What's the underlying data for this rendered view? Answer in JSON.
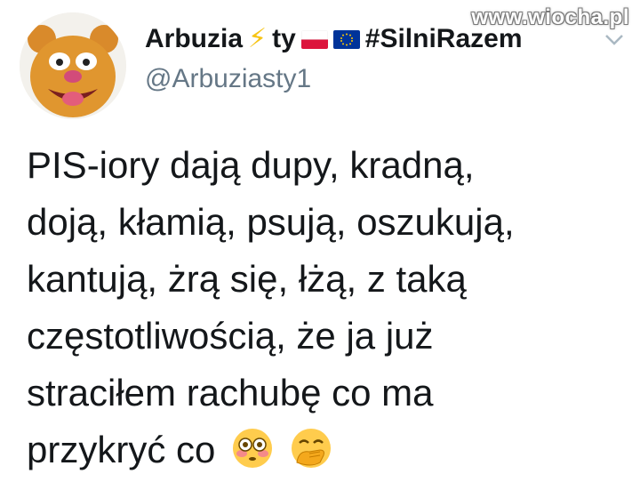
{
  "watermark": "www.wiocha.pl",
  "author": {
    "name_part1": "Arbuzia",
    "name_part2": "ty",
    "hashtag": "#SilniRazem",
    "handle": "@Arbuziasty1",
    "icons": [
      "lightning-bolt-icon",
      "poland-flag-icon",
      "eu-flag-icon"
    ],
    "bolt_glyph": "⚡"
  },
  "tweet": {
    "lines": [
      "PIS-iory dają dupy, kradną,",
      "doją, kłamią, psują, oszukują,",
      "kantują, żrą się, łżą, z taką",
      "częstotliwością, że ja już",
      "straciłem rachubę co ma",
      "przykryć co"
    ],
    "emojis": [
      "flushed-face-icon",
      "face-with-hand-over-mouth-icon"
    ]
  },
  "colors": {
    "text": "#14171a",
    "handle": "#657786",
    "bolt": "#f7c414",
    "eu_blue": "#003399",
    "poland_red": "#dc143c"
  }
}
